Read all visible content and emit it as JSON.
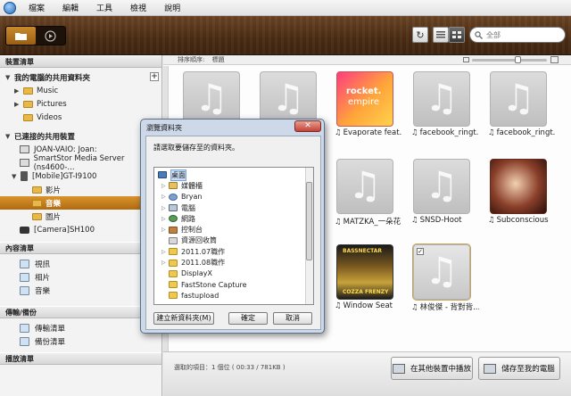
{
  "menu": {
    "items": [
      "檔案",
      "編輯",
      "工具",
      "檢視",
      "說明"
    ]
  },
  "toolbar": {
    "search_placeholder": "全部"
  },
  "sidebar": {
    "device_header": "裝置清單",
    "my_shared_title": "我的電腦的共用資料夾",
    "my_folders": [
      "Music",
      "Pictures",
      "Videos"
    ],
    "connected_title": "已連接的共用裝置",
    "connected": [
      "JOAN-VAIO: Joan:",
      "SmartStor Media Server  (ns4600-..."
    ],
    "mobile": "[Mobile]GT-I9100",
    "mobile_children": [
      "影片",
      "音樂",
      "圖片"
    ],
    "selected_child": "音樂",
    "camera": "[Camera]SH100",
    "content_header": "內容清單",
    "content_items": [
      "視訊",
      "相片",
      "音樂"
    ],
    "transfer_header": "傳輸/備份",
    "transfer_items": [
      "傳輸清單",
      "備份清單"
    ],
    "play_header": "播放清單"
  },
  "main": {
    "sort_label": "排序順序:",
    "sort_value": "標題",
    "tiles": [
      {
        "label": "",
        "art": "gray"
      },
      {
        "label": "",
        "art": "gray"
      },
      {
        "label": "Evaporate feat...",
        "art": "rocket"
      },
      {
        "label": "facebook_ringt...",
        "art": "gray"
      },
      {
        "label": "facebook_ringt...",
        "art": "gray"
      },
      {
        "label": "MATZKA_一朵花",
        "art": "gray"
      },
      {
        "label": "SNSD-Hoot",
        "art": "gray"
      },
      {
        "label": "Subconscious",
        "art": "sub"
      },
      {
        "label": "Window Seat",
        "art": "cozza"
      },
      {
        "label": "林俊傑 - 背對背...",
        "art": "gray"
      }
    ],
    "rocket_text": [
      "rocket.",
      "empire"
    ],
    "cozza_text": [
      "BASSNECTAR",
      "COZZA FRENZY"
    ],
    "status_text": "選取的項目：1 個位 ( 00:33 / 781KB )",
    "play_other_button": "在其他裝置中播放",
    "save_pc_button": "儲存至我的電腦"
  },
  "dialog": {
    "title": "瀏覽資料夾",
    "prompt": "請選取要儲存至的資料夾。",
    "nodes": [
      "桌面",
      "媒體櫃",
      "Bryan",
      "電腦",
      "網路",
      "控制台",
      "資源回收筒",
      "2011.07職作",
      "2011.08職作",
      "DisplayX",
      "FastStone Capture",
      "fastupload"
    ],
    "new_folder_button": "建立新資料夾(M)",
    "ok_button": "確定",
    "cancel_button": "取消"
  }
}
